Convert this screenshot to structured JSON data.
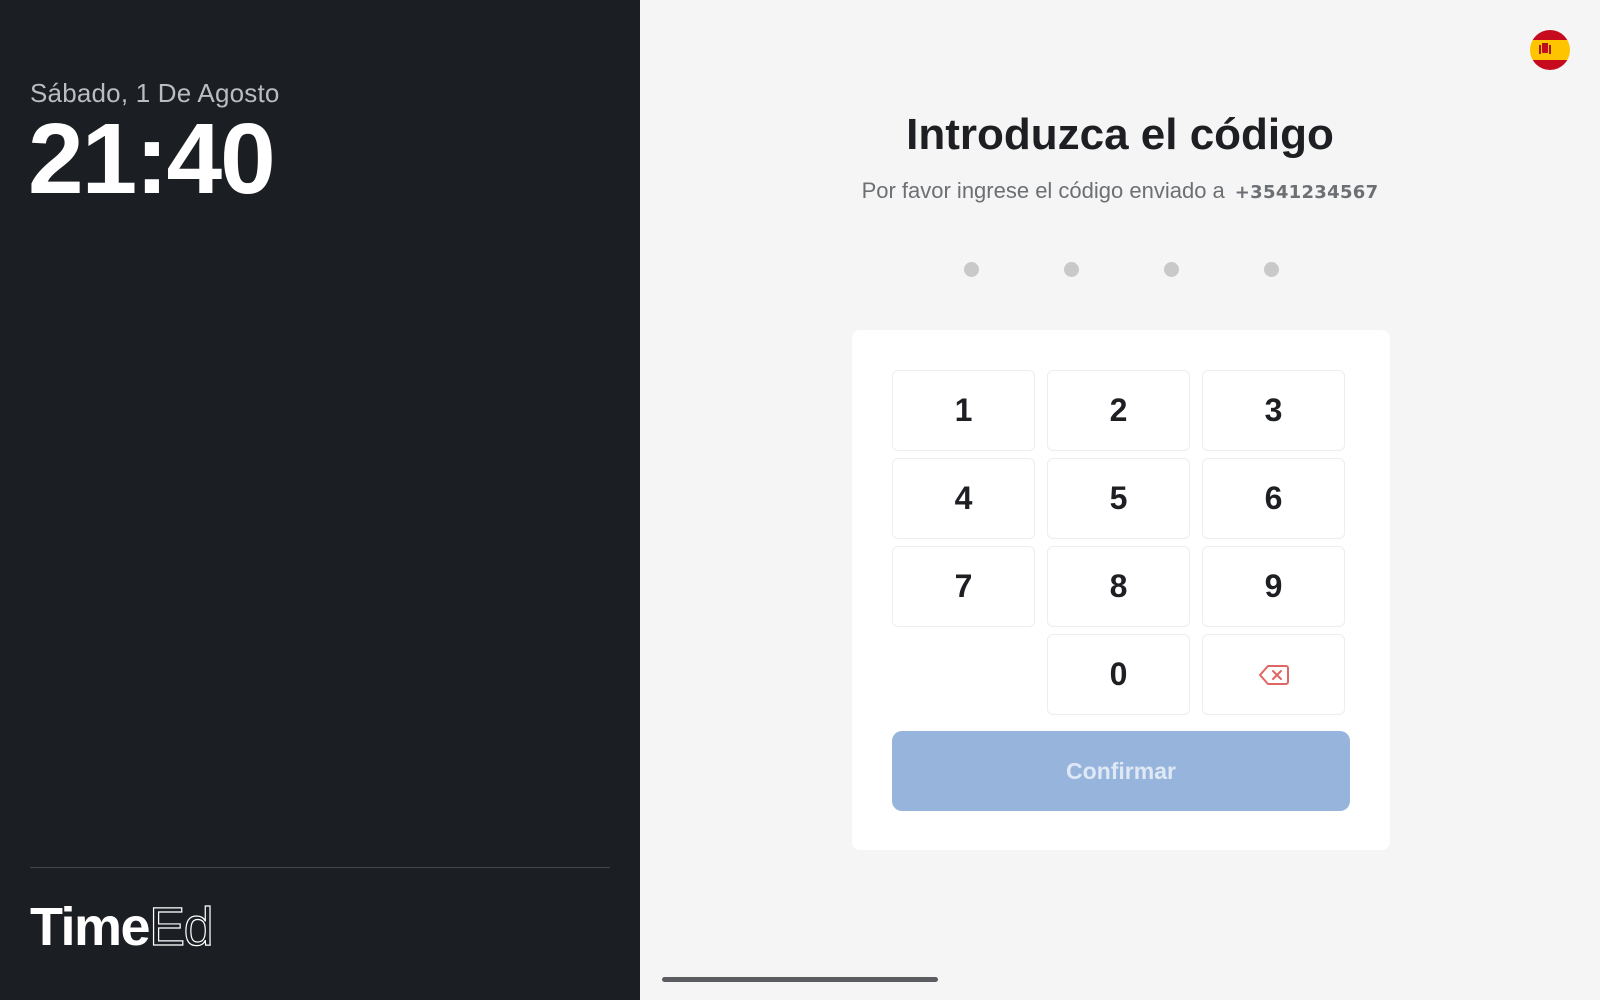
{
  "left": {
    "date": "Sábado, 1 De Agosto",
    "time": "21:40",
    "brand_part1": "Time",
    "brand_part2": "Ed"
  },
  "right": {
    "language_flag": "spain-flag-icon",
    "title": "Introduzca el código",
    "subtitle": "Por favor ingrese el código enviado a",
    "phone": "+3541234567",
    "code_length": 4,
    "code_entered": 0
  },
  "keypad": {
    "keys": [
      "1",
      "2",
      "3",
      "4",
      "5",
      "6",
      "7",
      "8",
      "9",
      "0"
    ],
    "delete_icon": "backspace-icon",
    "confirm_label": "Confirmar"
  },
  "colors": {
    "left_bg": "#1b1e22",
    "right_bg": "#f5f5f5",
    "confirm_bg": "#97b5dc",
    "delete_icon": "#e06666",
    "dot_empty": "#c9c9c9"
  }
}
